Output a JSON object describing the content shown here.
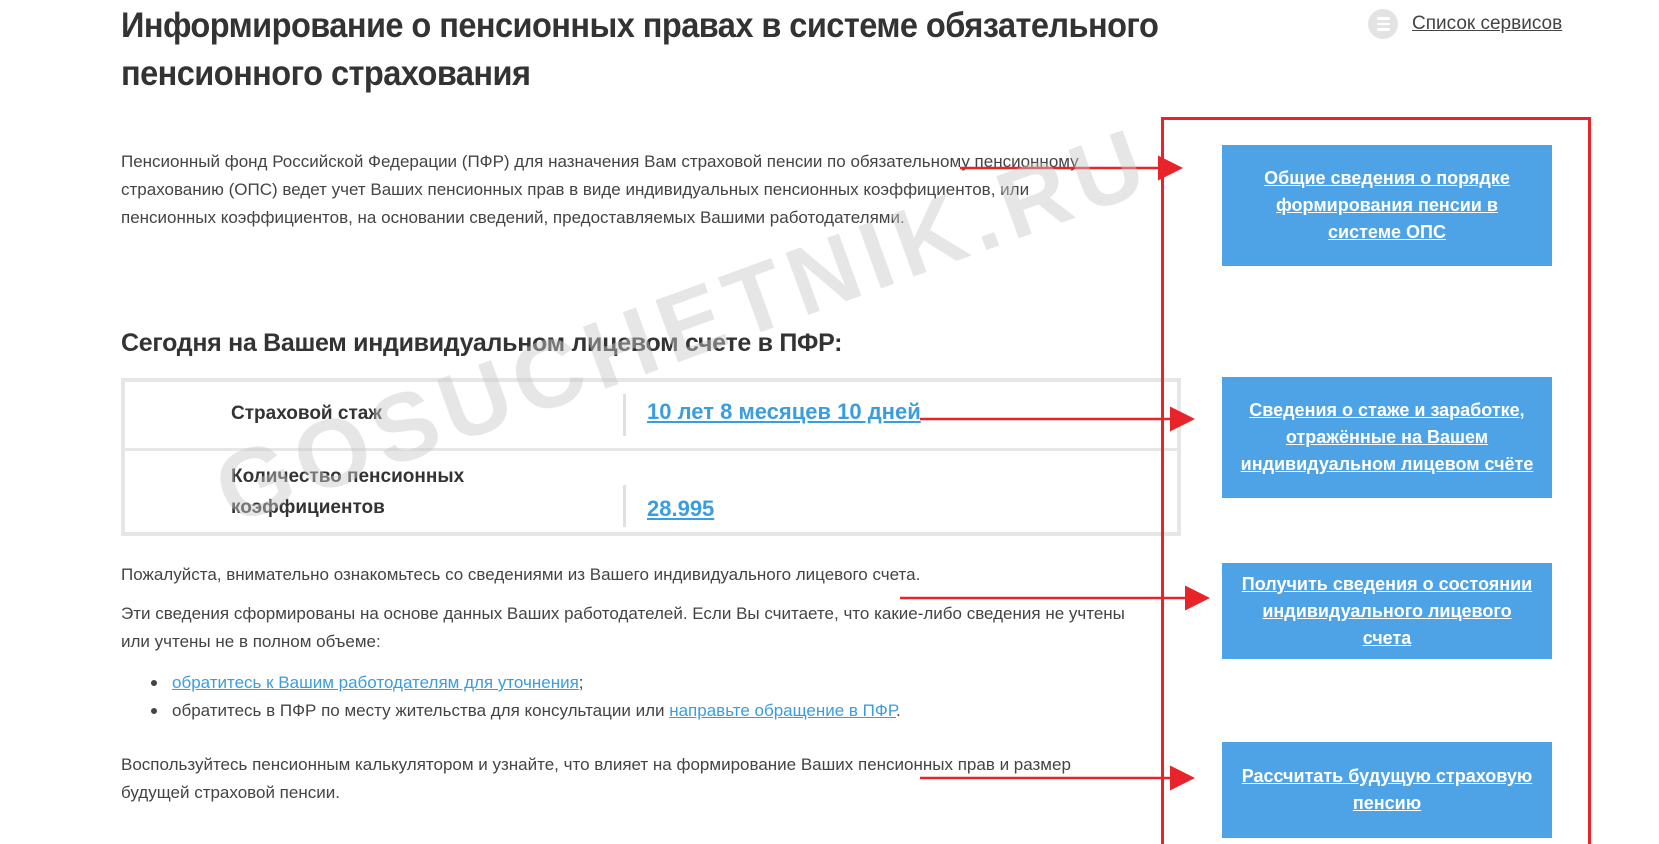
{
  "header": {
    "title": "Информирование о пенсионных правах в системе обязательного пенсионного страхования",
    "services_link": "Список сервисов"
  },
  "intro": {
    "text": "Пенсионный фонд Российской Федерации (ПФР) для назначения Вам страховой пенсии по обязательному пенсионному страхованию (ОПС) ведет учет Ваших пенсионных прав в виде индивидуальных пенсионных коэффициентов, или пенсионных коэффициентов, на основании сведений, предоставляемых Вашими работодателями."
  },
  "account": {
    "title": "Сегодня на Вашем индивидуальном лицевом счете в ПФР:",
    "rows": [
      {
        "label": "Страховой стаж",
        "value": "10 лет 8 месяцев 10 дней"
      },
      {
        "label": "Количество пенсионных коэффициентов",
        "value": "28.995"
      }
    ]
  },
  "body": {
    "p1": "Пожалуйста, внимательно ознакомьтесь со сведениями из Вашего индивидуального лицевого счета.",
    "p2": "Эти сведения сформированы на основе данных Ваших работодателей. Если Вы считаете, что какие-либо сведения не учтены или учтены не в полном объеме:",
    "bullet1_link": "обратитесь к Вашим работодателям для уточнения",
    "bullet1_suffix": ";",
    "bullet2_prefix": "обратитесь в ПФР по месту жительства для консультации или ",
    "bullet2_link": "направьте обращение в ПФР",
    "bullet2_suffix": ".",
    "p3": "Воспользуйтесь пенсионным калькулятором и узнайте, что влияет на формирование Ваших пенсионных прав и размер будущей страховой пенсии."
  },
  "sidebar": {
    "buttons": [
      "Общие сведения о порядке формирования пенсии в системе ОПС",
      "Сведения о стаже и заработке, отражённые на Вашем индивидуальном лицевом счёте",
      "Получить сведения о состоянии индивидуального лицевого счета",
      "Рассчитать будущую страховую пенсию"
    ]
  },
  "watermark": "GOSUCHETNIK.RU",
  "colors": {
    "link": "#3a9de0",
    "button": "#4da3e6",
    "annotation": "#e8232a",
    "text": "#333333"
  }
}
